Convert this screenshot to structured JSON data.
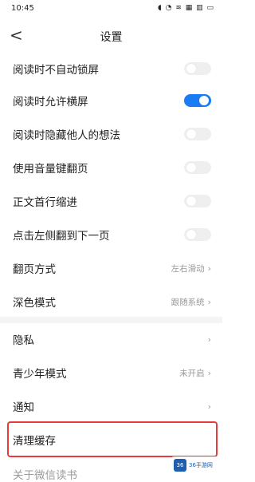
{
  "status": {
    "time": "10:45",
    "icons_text": "◖ ◔ ≋ ▦ ▥ ▭"
  },
  "nav": {
    "back": "<",
    "title": "设置"
  },
  "settings": [
    {
      "label": "阅读时不自动锁屏",
      "toggle": false
    },
    {
      "label": "阅读时允许横屏",
      "toggle": true
    },
    {
      "label": "阅读时隐藏他人的想法",
      "toggle": false
    },
    {
      "label": "使用音量键翻页",
      "toggle": false
    },
    {
      "label": "正文首行缩进",
      "toggle": false
    },
    {
      "label": "点击左侧翻到下一页",
      "toggle": false
    },
    {
      "label": "翻页方式",
      "value": "左右滑动"
    },
    {
      "label": "深色模式",
      "value": "跟随系统"
    }
  ],
  "section2": [
    {
      "label": "隐私",
      "value": ""
    },
    {
      "label": "青少年模式",
      "value": "未开启"
    },
    {
      "label": "通知",
      "value": ""
    },
    {
      "label": "清理缓存",
      "value": ""
    }
  ],
  "partial_label": "关于微信读书",
  "watermark": {
    "logo": "36",
    "text": "36手游网"
  },
  "colors": {
    "toggle_on": "#1a7cf5",
    "highlight": "#e53b3b"
  }
}
